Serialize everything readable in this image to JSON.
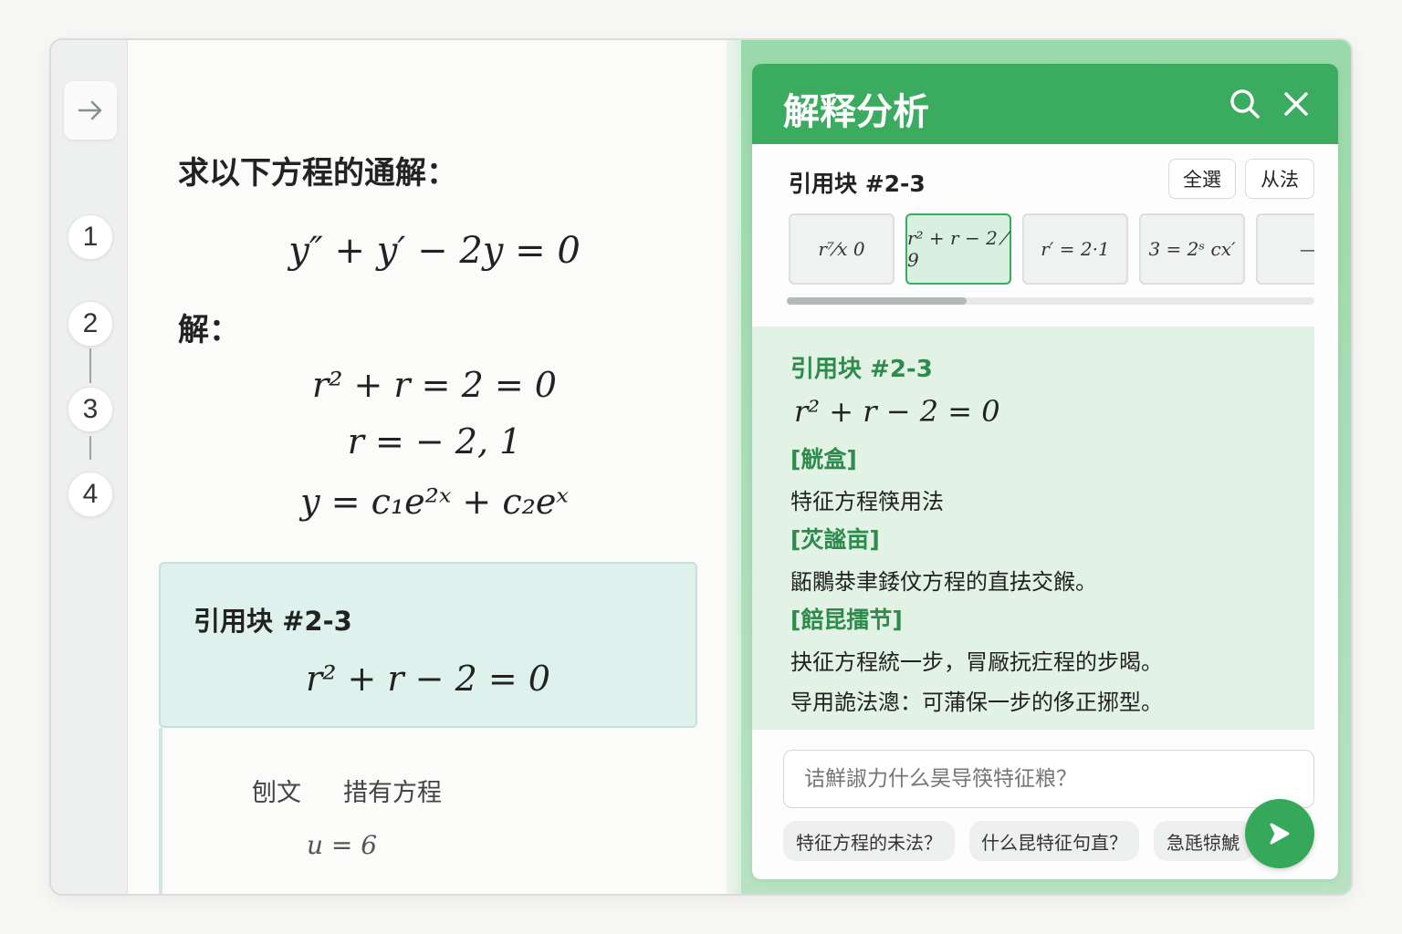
{
  "sidebar": {
    "collapse_icon": "arrow-right-icon",
    "steps": [
      "1",
      "2",
      "3",
      "4"
    ]
  },
  "document": {
    "title": "求以下方程的通解：",
    "equation": "y″ + y′ − 2y = 0",
    "solution_label": "解：",
    "steps": [
      "r² + r = 2 = 0",
      "r = − 2, 1",
      "y = c₁e²ˣ + c₂eˣ"
    ],
    "quote_card": {
      "title": "引用块 #2-3",
      "equation": "r² + r − 2 = 0"
    },
    "reference": {
      "label": "刨文",
      "type": "措有方程",
      "equation": "u = 6"
    }
  },
  "panel": {
    "title": "解释分析",
    "search_icon": "search-icon",
    "close_icon": "close-icon",
    "quote_block_label": "引用块 #2-3",
    "select_all": "全選",
    "method": "从法",
    "thumbnails": [
      "r⁷⁄x  0",
      "r² + r − 2 ⁄ 9",
      "r′ = 2·1",
      "3 = 2ˢ cx′",
      "—"
    ],
    "scroll_position": 0.34,
    "analysis": {
      "title": "引用块 #2-3",
      "equation": "r² + r − 2 = 0",
      "sections": [
        {
          "heading": "[觥盒]",
          "lines": [
            "特征方程筷用法"
          ]
        },
        {
          "heading": "[苂謐亩]",
          "lines": [
            "鼫鷴㳟聿錗伩方程的直抾交餱。"
          ]
        },
        {
          "heading": "[餢昆擂节]",
          "lines": [
            "抉征方程統一步，冐厰抏疘程的步暍。",
            "导用詭法漗：可蒲保一步的侈正捓型。"
          ]
        }
      ]
    },
    "question_placeholder": "诘鮮諔力什么昊导筷特征粮？",
    "chips": [
      "特征方程的未法？",
      "什么昆特征句直？",
      "急瓱㹁鯱"
    ],
    "send_icon": "send-icon",
    "accent_color": "#3bab5f"
  }
}
